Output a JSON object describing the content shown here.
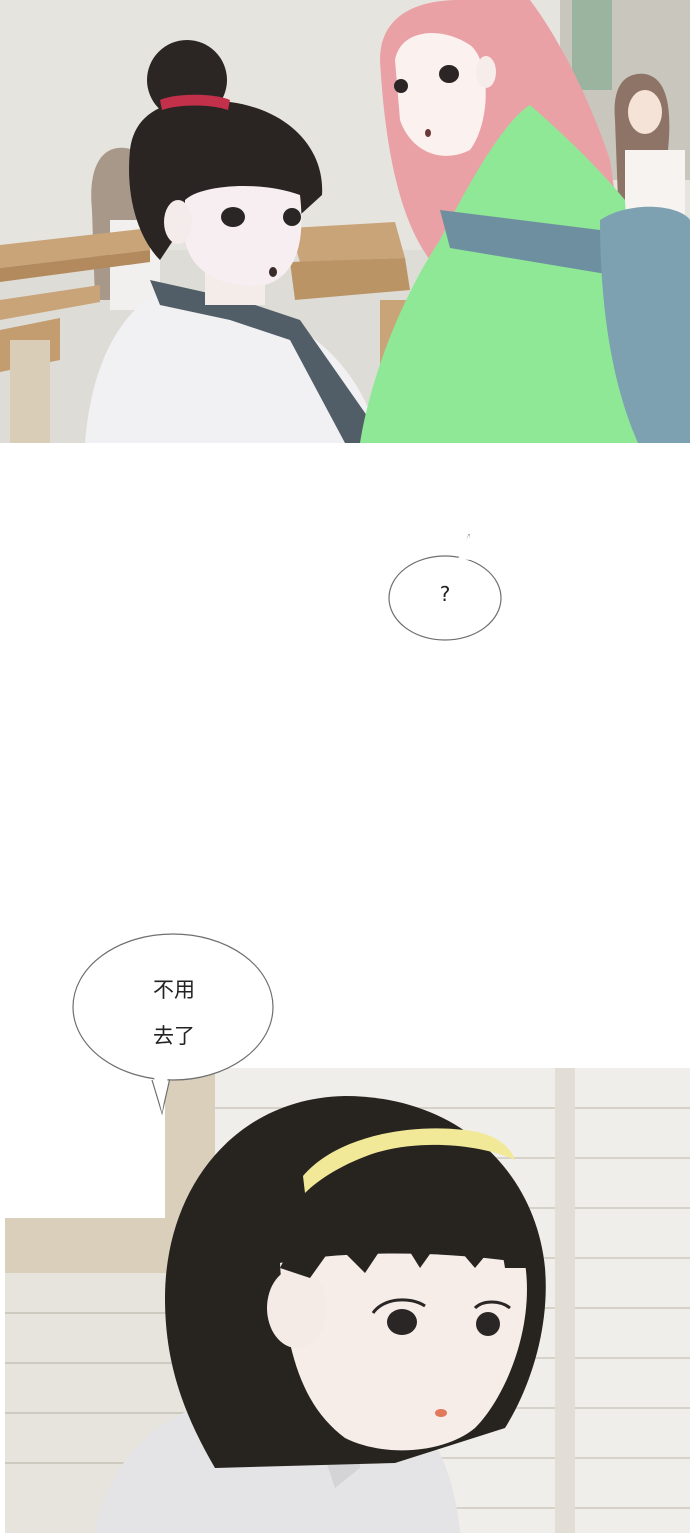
{
  "panels": [
    {
      "scene": "classroom-two-students-turning"
    },
    {
      "scene": "girl-with-headband-closeup"
    }
  ],
  "bubbles": {
    "question": {
      "text": "?"
    },
    "reply": {
      "line1": "不用",
      "line2": "去了"
    }
  }
}
